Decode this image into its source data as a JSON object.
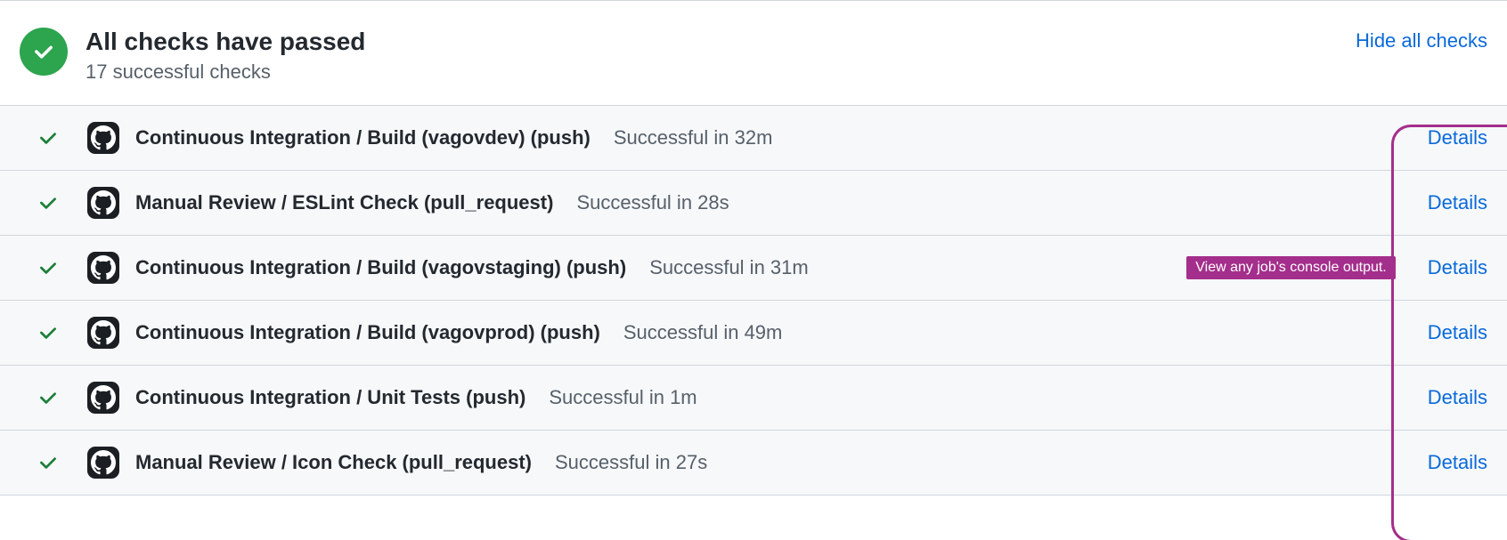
{
  "header": {
    "title": "All checks have passed",
    "subtitle": "17 successful checks",
    "hide_link": "Hide all checks"
  },
  "tooltip": "View any job's console output.",
  "details_label": "Details",
  "checks": [
    {
      "name": "Continuous Integration / Build (vagovdev) (push)",
      "status": "Successful in 32m",
      "tooltip": false
    },
    {
      "name": "Manual Review / ESLint Check (pull_request)",
      "status": "Successful in 28s",
      "tooltip": false
    },
    {
      "name": "Continuous Integration / Build (vagovstaging) (push)",
      "status": "Successful in 31m",
      "tooltip": true
    },
    {
      "name": "Continuous Integration / Build (vagovprod) (push)",
      "status": "Successful in 49m",
      "tooltip": false
    },
    {
      "name": "Continuous Integration / Unit Tests (push)",
      "status": "Successful in 1m",
      "tooltip": false
    },
    {
      "name": "Manual Review / Icon Check (pull_request)",
      "status": "Successful in 27s",
      "tooltip": false
    }
  ]
}
